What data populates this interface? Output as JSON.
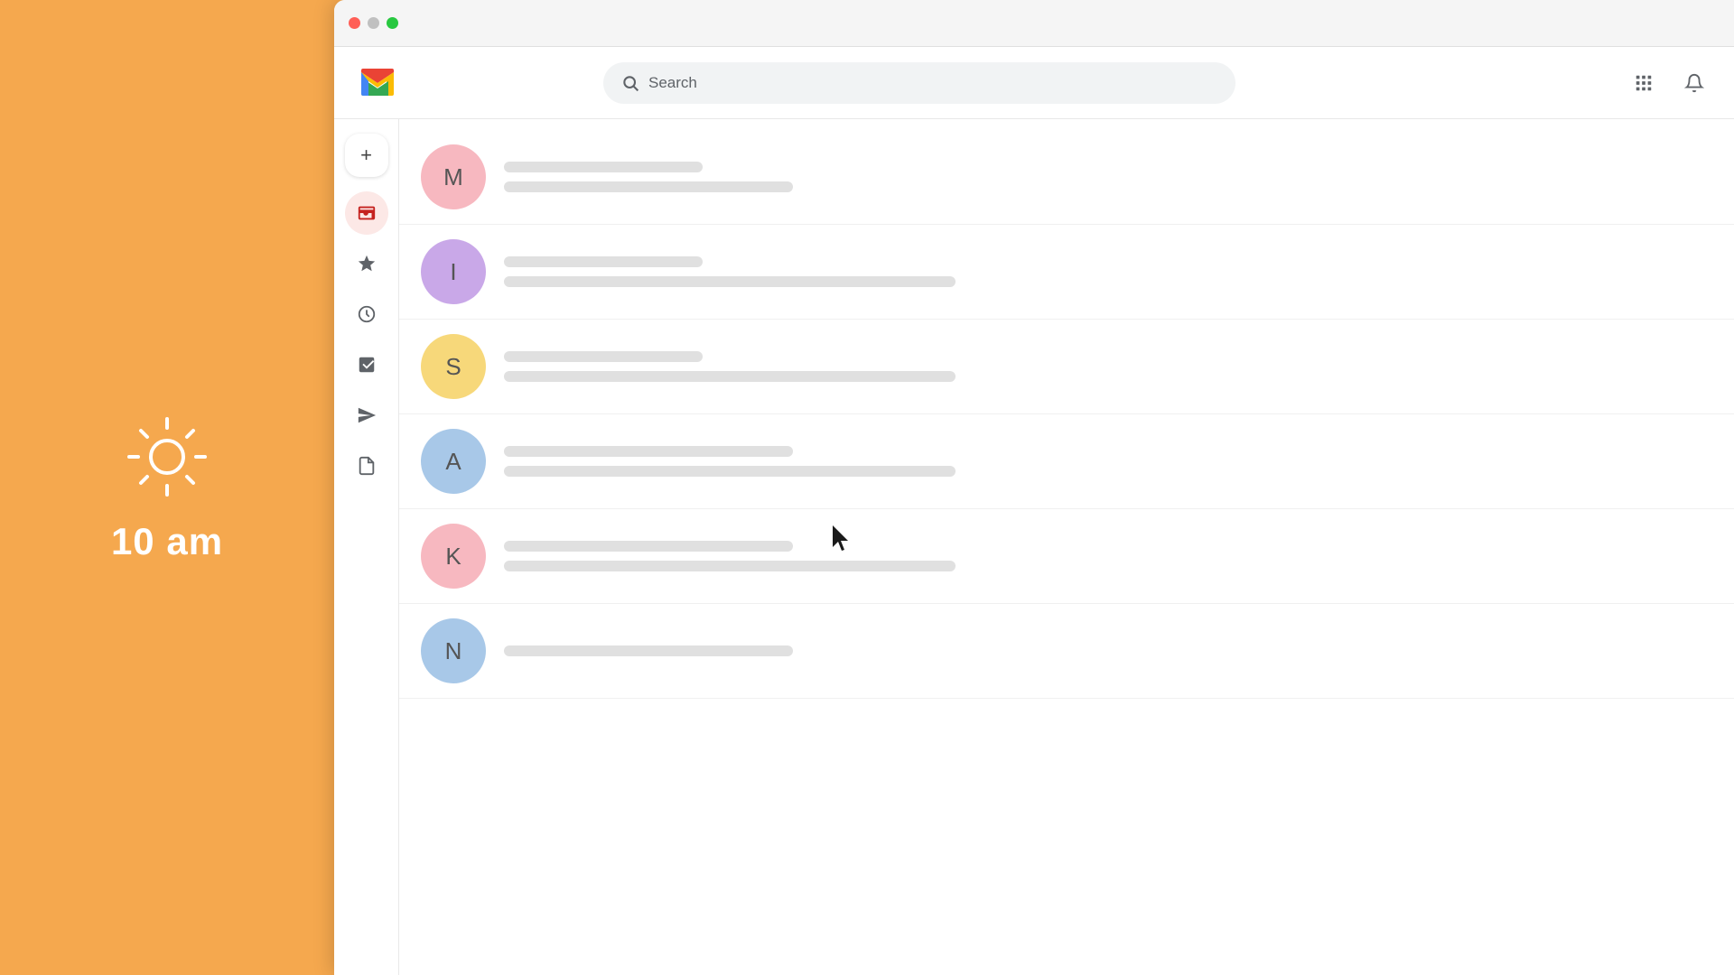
{
  "left_panel": {
    "time": "10 am"
  },
  "window": {
    "title": "Gmail"
  },
  "header": {
    "search_placeholder": "Search",
    "logo_alt": "Gmail"
  },
  "sidebar": {
    "compose_label": "+",
    "nav_items": [
      {
        "id": "inbox",
        "icon": "inbox",
        "active": true
      },
      {
        "id": "starred",
        "icon": "star"
      },
      {
        "id": "snoozed",
        "icon": "clock"
      },
      {
        "id": "important",
        "icon": "label"
      },
      {
        "id": "sent",
        "icon": "send"
      },
      {
        "id": "drafts",
        "icon": "draft"
      }
    ]
  },
  "emails": [
    {
      "id": "1",
      "initial": "M",
      "color": "#f7b8c0"
    },
    {
      "id": "2",
      "initial": "I",
      "color": "#c9a8e8"
    },
    {
      "id": "3",
      "initial": "S",
      "color": "#f7d87a"
    },
    {
      "id": "4",
      "initial": "A",
      "color": "#a8c8e8"
    },
    {
      "id": "5",
      "initial": "K",
      "color": "#f7b8c0"
    },
    {
      "id": "6",
      "initial": "N",
      "color": "#a8c8e8"
    }
  ],
  "colors": {
    "orange": "#f5a84e",
    "white": "#ffffff"
  }
}
